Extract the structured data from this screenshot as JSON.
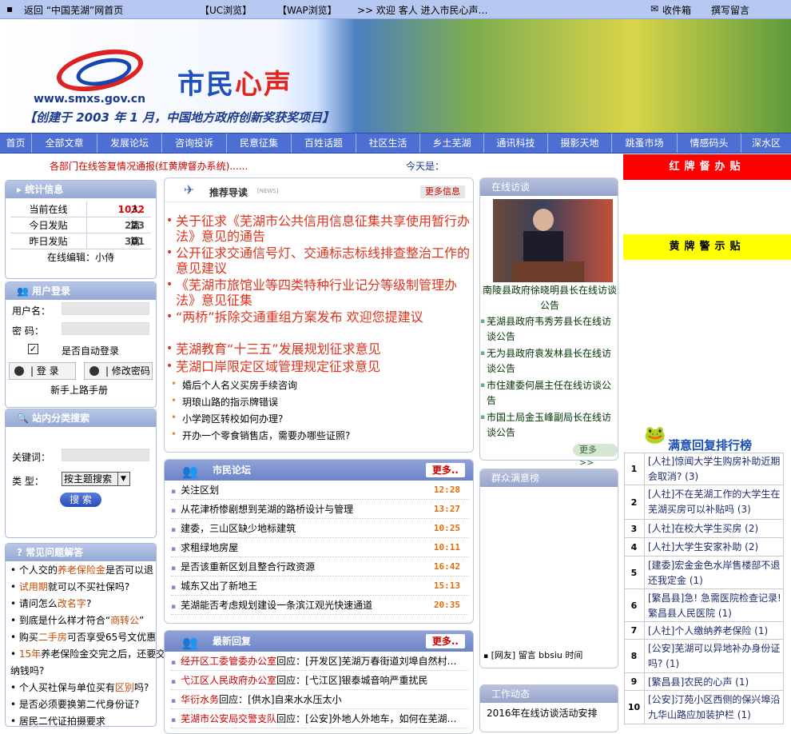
{
  "topbar": {
    "back_home": "返回 “中国芜湖”网首页",
    "uc": "【UC浏览】",
    "wap": "【WAP浏览】",
    "welcome": ">> 欢迎 客人 进入市民心声…",
    "inbox": "收件箱",
    "write_msg": "撰写留言"
  },
  "banner": {
    "brand_a": "市民",
    "brand_b": "心声",
    "url": "www.smxs.gov.cn",
    "slogan": "【创建于 2003 年 1 月，中国地方政府创新奖获奖项目】"
  },
  "nav": [
    "首页",
    "全部文章",
    "发展论坛",
    "咨询投诉",
    "民意征集",
    "百姓话题",
    "社区生活",
    "乡土芜湖",
    "通讯科技",
    "摄影天地",
    "跳蚤市场",
    "情感码头",
    "深水区"
  ],
  "ticker": {
    "text": "各部门在线答复情况通报(红黄牌督办系统)......",
    "today": "今天是："
  },
  "side_banners": {
    "red": "红牌督办贴",
    "yellow": "黄牌警示贴"
  },
  "stats": {
    "title": "统计信息",
    "rows": [
      {
        "k": "当前在线",
        "v": "1032",
        "u": "人"
      },
      {
        "k": "今日发贴",
        "v": "223",
        "u": "篇"
      },
      {
        "k": "昨日发贴",
        "v": "301",
        "u": "篇"
      }
    ],
    "editor": "在线编辑：小侍"
  },
  "login": {
    "title": "用户登录",
    "user_label": "用户名：",
    "pass_label": "密 码：",
    "auto_login": "是否自动登录",
    "login_btn": "| 登 录",
    "change_pwd_btn": "| 修改密码",
    "manual": "新手上路手册"
  },
  "search": {
    "title": "站内分类搜索",
    "keyword_label": "关键词：",
    "type_label": "类 型：",
    "type_value": "按主题搜索",
    "submit": "搜 索"
  },
  "faq": {
    "title": "常见问题解答",
    "lines": [
      [
        {
          "t": "个人交的"
        },
        {
          "t": "养老保险金",
          "h": true
        },
        {
          "t": "是否可以退"
        }
      ],
      [
        {
          "t": "试用期",
          "h": true
        },
        {
          "t": "就可以不买社保吗?"
        }
      ],
      [
        {
          "t": "请问怎么"
        },
        {
          "t": "改名字",
          "h": true
        },
        {
          "t": "?"
        }
      ],
      [
        {
          "t": "到底是什么样才符合“"
        },
        {
          "t": "商转公",
          "h": true
        },
        {
          "t": "”"
        }
      ],
      [
        {
          "t": "购买"
        },
        {
          "t": "二手房",
          "h": true
        },
        {
          "t": "可否享受65号文优惠"
        }
      ],
      [
        {
          "t": "15年",
          "h": true
        },
        {
          "t": "养老保险金交完之后，还要交"
        }
      ],
      [
        {
          "t": "纳钱吗?"
        }
      ],
      [
        {
          "t": "个人买社保与单位买有"
        },
        {
          "t": "区别",
          "h": true
        },
        {
          "t": "吗?"
        }
      ],
      [
        {
          "t": "是否必须要换第二代身份证?"
        }
      ],
      [
        {
          "t": "居民二代证拍摄要求"
        }
      ]
    ]
  },
  "recommend": {
    "title": "推荐导读",
    "tag": "[NEWS]",
    "more": "更多信息",
    "big": [
      "关于征求《芜湖市公共信用信息征集共享使用暂行办法》意见的通告",
      "公开征求交通信号灯、交通标志标线排查整治工作的意见建议",
      "《芜湖市旅馆业等四类特种行业记分等级制管理办法》意见征集",
      "“两桥”拆除交通重组方案发布 欢迎您提建议",
      "芜湖教育“十三五”发展规划征求意见",
      "芜湖口岸限定区域管理规定征求意见"
    ],
    "small": [
      "婚后个人名义买房手续咨询",
      "玥琅山路的指示牌错误",
      "小学跨区转校如何办理?",
      "开办一个零食销售店，需要办哪些证照?"
    ]
  },
  "forum": {
    "title": "市民论坛",
    "more": "更多..",
    "rows": [
      {
        "text": "关注区划",
        "time": "12:28"
      },
      {
        "text": "从花津桥惨剧想到芜湖的路桥设计与管理",
        "time": "13:27"
      },
      {
        "text": "建委，三山区缺少地标建筑",
        "time": "10:25"
      },
      {
        "text": "求租绿地房屋",
        "time": "10:11"
      },
      {
        "text": "是否该重新区划且整合行政资源",
        "time": "16:42"
      },
      {
        "text": "城东又出了新地王",
        "time": "15:13"
      },
      {
        "text": "芜湖能否考虑规划建设一条滨江观光快速通道",
        "time": "20:35"
      }
    ]
  },
  "replies": {
    "title": "最新回复",
    "more": "更多..",
    "rows": [
      {
        "org": "经开区工委管委办公室",
        "mid": "回应：",
        "text": "[开发区]芜湖万春街道刘埠自然村…"
      },
      {
        "org": "弋江区人民政府办公室",
        "mid": "回应：",
        "text": "[弋江区]银泰城音响严重扰民"
      },
      {
        "org": "华衍水务",
        "mid": "回应：",
        "text": "[供水]自来水水压太小"
      },
      {
        "org": "芜湖市公安局交警支队",
        "mid": "回应：",
        "text": "[公安]外地人外地车，如何在芜湖…"
      }
    ]
  },
  "visit": {
    "title": "在线访谈",
    "photo_caption": "南陵县政府徐晓明县长在线访谈公告",
    "items": [
      "芜湖县政府韦秀芳县长在线访谈公告",
      "无为县政府袁发林县长在线访谈公告",
      "市住建委何晨主任在线访谈公告",
      "市国土局金玉峰副局长在线访谈公告"
    ],
    "more": "更多>>"
  },
  "satisfaction": {
    "title": "群众满意榜",
    "line": "[网友]  留言 bbsiu 时间"
  },
  "work": {
    "title": "工作动态",
    "first": "2016年在线访谈活动安排"
  },
  "ranking": {
    "title": "满意回复排行榜",
    "rows": [
      {
        "n": "1",
        "t": "[人社]惊闻大学生购房补助近期会取消? (3)"
      },
      {
        "n": "2",
        "t": "[人社]不在芜湖工作的大学生在芜湖买房可以补贴吗 (3)"
      },
      {
        "n": "3",
        "t": "[人社]在校大学生买房 (2)"
      },
      {
        "n": "4",
        "t": "[人社]大学生安家补助 (2)"
      },
      {
        "n": "5",
        "t": "[建委]宏金金色水岸售楼部不退还我定金 (1)"
      },
      {
        "n": "6",
        "t": "[繁昌县]急! 急需医院检查记录! 繁昌县人民医院 (1)"
      },
      {
        "n": "7",
        "t": "[人社]个人缴纳养老保险 (1)"
      },
      {
        "n": "8",
        "t": "[公安]芜湖可以异地补办身份证吗? (1)"
      },
      {
        "n": "9",
        "t": "[繁昌县]农民的心声 (1)"
      },
      {
        "n": "10",
        "t": "[公安]汀苑小区西侧的保兴埠沿九华山路应加装护栏 (1)"
      }
    ]
  }
}
